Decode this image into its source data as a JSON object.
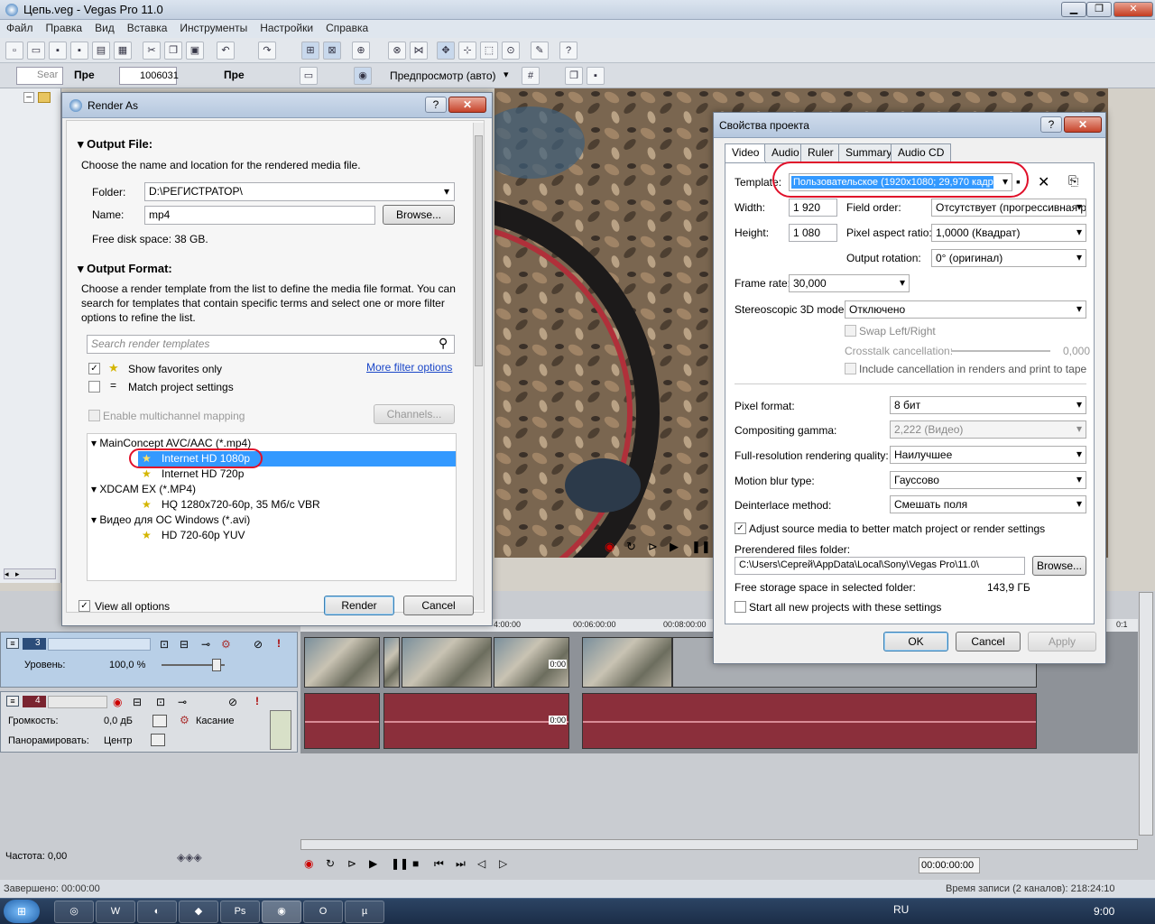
{
  "app": {
    "title": "Цепь.veg - Vegas Pro 11.0",
    "menu": [
      "Файл",
      "Правка",
      "Вид",
      "Вставка",
      "Инструменты",
      "Настройки",
      "Справка"
    ],
    "search_placeholder": "Sear",
    "explorer_label": "Пре",
    "folder_label": "1006031",
    "preview_mode": "Предпросмотр (авто)"
  },
  "render": {
    "title": "Render As",
    "output_file_header": "Output File:",
    "output_file_desc": "Choose the name and location for the rendered media file.",
    "folder_label": "Folder:",
    "folder_value": "D:\\РЕГИСТРАТОР\\",
    "name_label": "Name:",
    "name_value": "mp4",
    "browse": "Browse...",
    "free_disk": "Free disk space: 38 GB.",
    "output_format_header": "Output Format:",
    "output_format_desc": "Choose a render template from the list to define the media file format. You can search for templates that contain specific terms and select one or more filter options to refine the list.",
    "search_placeholder": "Search render templates",
    "show_favorites": "Show favorites only",
    "more_filter": "More filter options",
    "match_project": "Match project settings",
    "multichannel": "Enable multichannel mapping",
    "channels": "Channels...",
    "tree": [
      {
        "group": "MainConcept AVC/AAC (*.mp4)",
        "items": [
          "Internet HD 1080p",
          "Internet HD 720p"
        ]
      },
      {
        "group": "XDCAM EX (*.MP4)",
        "items": [
          "HQ 1280x720-60p, 35 Мб/с VBR"
        ]
      },
      {
        "group": "Видео для ОС Windows (*.avi)",
        "items": [
          "HD 720-60p YUV"
        ]
      }
    ],
    "view_all": "View all options",
    "render_btn": "Render",
    "cancel_btn": "Cancel"
  },
  "props": {
    "title": "Свойства проекта",
    "tabs": [
      "Video",
      "Audio",
      "Ruler",
      "Summary",
      "Audio CD"
    ],
    "template_label": "Template:",
    "template_value": "Пользовательское (1920x1080; 29,970 кадр.",
    "width_label": "Width:",
    "width_value": "1 920",
    "height_label": "Height:",
    "height_value": "1 080",
    "field_order_label": "Field order:",
    "field_order_value": "Отсутствует (прогрессивная р",
    "par_label": "Pixel aspect ratio:",
    "par_value": "1,0000 (Квадрат)",
    "rotation_label": "Output rotation:",
    "rotation_value": "0° (оригинал)",
    "frame_rate_label": "Frame rate:",
    "frame_rate_value": "30,000",
    "stereo_label": "Stereoscopic 3D mode:",
    "stereo_value": "Отключено",
    "swap": "Swap Left/Right",
    "crosstalk": "Crosstalk cancellation:",
    "crosstalk_value": "0,000",
    "include_cancel": "Include cancellation in renders and print to tape",
    "pixel_format_label": "Pixel format:",
    "pixel_format_value": "8 бит",
    "gamma_label": "Compositing gamma:",
    "gamma_value": "2,222 (Видео)",
    "quality_label": "Full-resolution rendering quality:",
    "quality_value": "Наилучшее",
    "blur_label": "Motion blur type:",
    "blur_value": "Гауссово",
    "deint_label": "Deinterlace method:",
    "deint_value": "Смешать поля",
    "adjust": "Adjust source media to better match project or render settings",
    "prerender_label": "Prerendered files folder:",
    "prerender_value": "C:\\Users\\Сергей\\AppData\\Local\\Sony\\Vegas Pro\\11.0\\",
    "browse": "Browse...",
    "free_storage": "Free storage space in selected folder:",
    "free_storage_value": "143,9 ГБ",
    "start_all": "Start all new projects with these settings",
    "ok": "OK",
    "cancel": "Cancel",
    "apply": "Apply"
  },
  "timeline": {
    "video_track_no": "3",
    "level_label": "Уровень:",
    "level_value": "100,0 %",
    "audio_track_no": "4",
    "volume_label": "Громкость:",
    "volume_value": "0,0 дБ",
    "touch": "Касание",
    "pan_label": "Панорамировать:",
    "pan_value": "Центр",
    "ruler": [
      "4:00:00",
      "00:06:00:00",
      "00:08:00:00",
      "0:1"
    ],
    "clip_time": "0:00",
    "rate": "Частота: 0,00",
    "time_code": "00:00:00:00"
  },
  "status": {
    "done": "Завершено: 00:00:00",
    "rec_time": "Время записи (2 каналов): 218:24:10"
  },
  "taskbar": {
    "lang": "RU",
    "clock": "9:00"
  }
}
